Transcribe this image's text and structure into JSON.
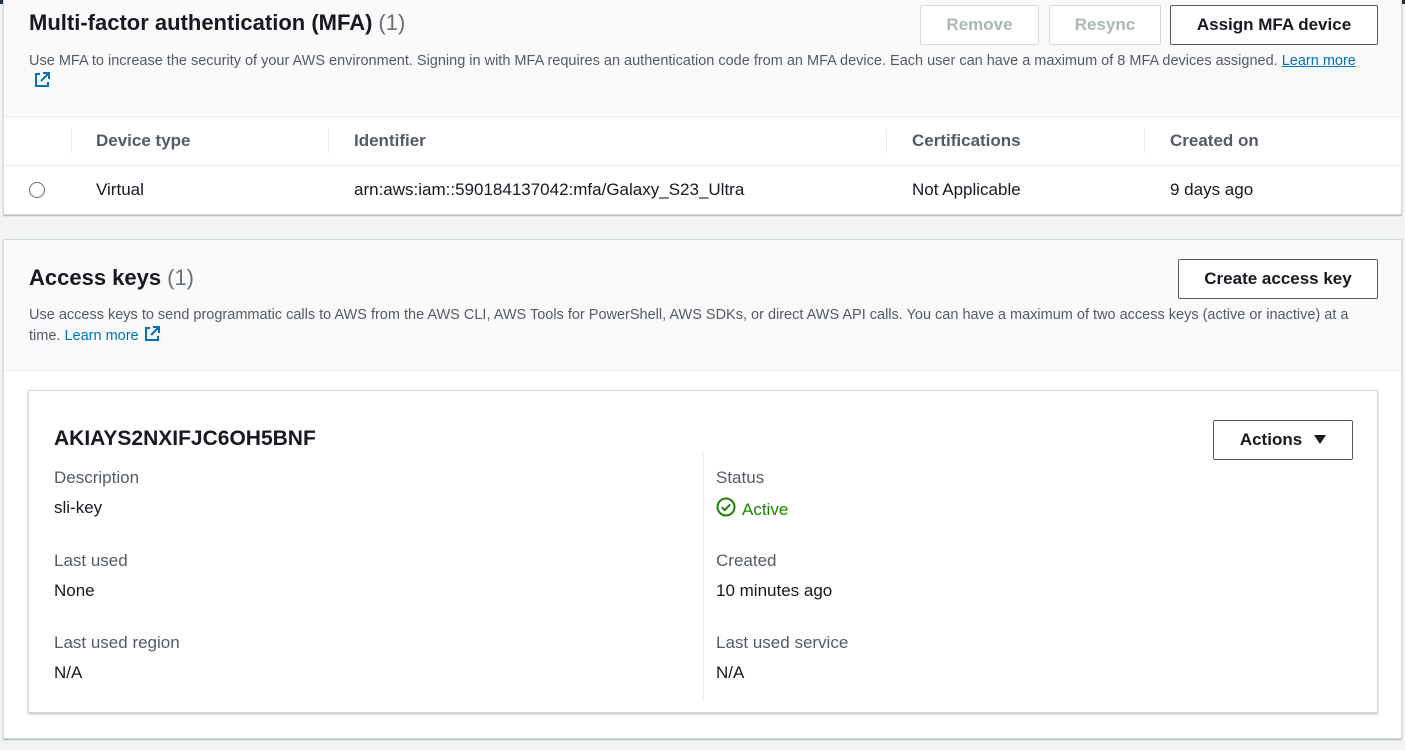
{
  "mfa": {
    "title": "Multi-factor authentication (MFA)",
    "count": "(1)",
    "description": "Use MFA to increase the security of your AWS environment. Signing in with MFA requires an authentication code from an MFA device. Each user can have a maximum of 8 MFA devices assigned.",
    "learn_more": "Learn more",
    "buttons": {
      "remove": "Remove",
      "resync": "Resync",
      "assign": "Assign MFA device"
    },
    "table": {
      "headers": [
        "Device type",
        "Identifier",
        "Certifications",
        "Created on"
      ],
      "rows": [
        [
          "Virtual",
          "arn:aws:iam::590184137042:mfa/Galaxy_S23_Ultra",
          "Not Applicable",
          "9 days ago"
        ]
      ]
    }
  },
  "access_keys": {
    "title": "Access keys",
    "count": "(1)",
    "description": "Use access keys to send programmatic calls to AWS from the AWS CLI, AWS Tools for PowerShell, AWS SDKs, or direct AWS API calls. You can have a maximum of two access keys (active or inactive) at a time.",
    "learn_more": "Learn more",
    "create_button": "Create access key",
    "key": {
      "id": "AKIAYS2NXIFJC6OH5BNF",
      "actions_label": "Actions",
      "description_label": "Description",
      "description_value": "sli-key",
      "last_used_label": "Last used",
      "last_used_value": "None",
      "last_used_region_label": "Last used region",
      "last_used_region_value": "N/A",
      "status_label": "Status",
      "status_value": "Active",
      "created_label": "Created",
      "created_value": "10 minutes ago",
      "last_used_service_label": "Last used service",
      "last_used_service_value": "N/A"
    }
  },
  "colors": {
    "link": "#0073bb",
    "success": "#1d8102",
    "header_bar": "#232f3e"
  },
  "icons": {
    "external_link": "external-link-icon",
    "status_ok": "check-circle-icon",
    "dropdown": "caret-down-icon"
  }
}
